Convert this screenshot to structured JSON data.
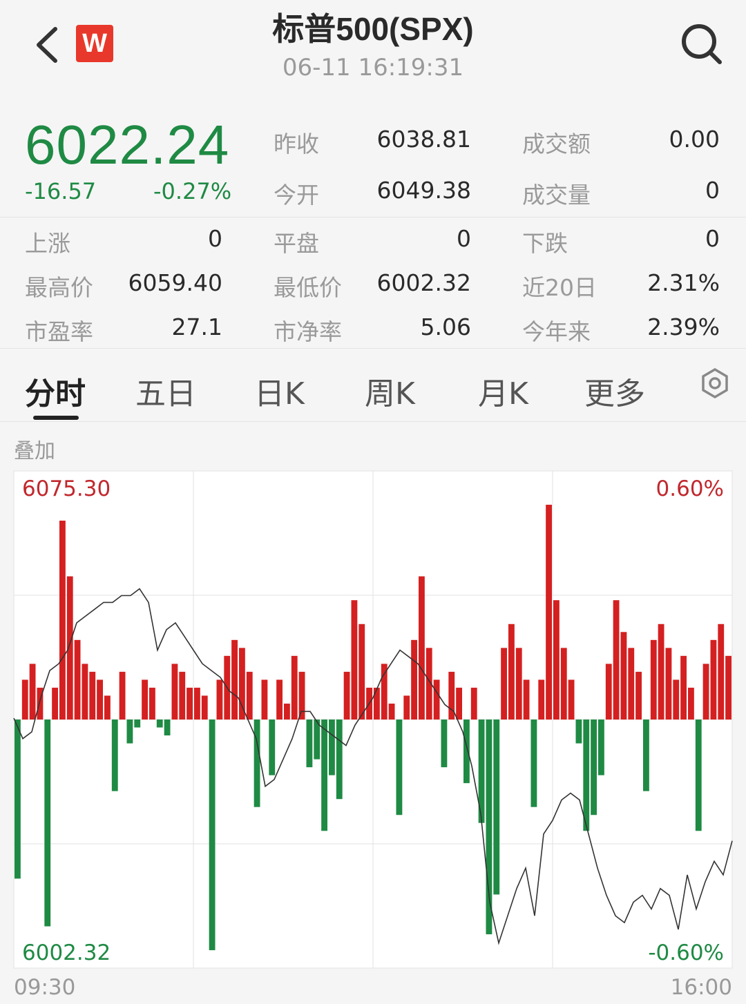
{
  "header": {
    "title": "标普500(SPX)",
    "timestamp": "06-11 16:19:31",
    "logo_text": "W",
    "back_icon": "chevron-left-icon",
    "search_icon": "search-icon"
  },
  "quote": {
    "price": "6022.24",
    "change": "-16.57",
    "change_pct": "-0.27%"
  },
  "stats": [
    {
      "label": "昨收",
      "value": "6038.81"
    },
    {
      "label": "成交额",
      "value": "0.00"
    },
    {
      "label": "今开",
      "value": "6049.38"
    },
    {
      "label": "成交量",
      "value": "0"
    },
    {
      "label": "上涨",
      "value": "0"
    },
    {
      "label": "平盘",
      "value": "0"
    },
    {
      "label": "下跌",
      "value": "0"
    },
    {
      "label": "最高价",
      "value": "6059.40"
    },
    {
      "label": "最低价",
      "value": "6002.32"
    },
    {
      "label": "近20日",
      "value": "2.31%"
    },
    {
      "label": "市盈率",
      "value": "27.1"
    },
    {
      "label": "市净率",
      "value": "5.06"
    },
    {
      "label": "今年来",
      "value": "2.39%"
    }
  ],
  "tabs": [
    {
      "label": "分时"
    },
    {
      "label": "五日"
    },
    {
      "label": "日K"
    },
    {
      "label": "周K"
    },
    {
      "label": "月K"
    },
    {
      "label": "更多"
    }
  ],
  "settings_icon": "gear-icon",
  "overlay_label": "叠加",
  "colors": {
    "up": "#d42020",
    "down": "#1f8a44",
    "line": "#333333",
    "grid": "#e2e2e2"
  },
  "chart_data": {
    "type": "line",
    "x_start": "09:30",
    "x_end": "16:00",
    "y_max_label": "6075.30",
    "y_min_label": "6002.32",
    "pct_max_label": "0.60%",
    "pct_min_label": "-0.60%",
    "ylim": [
      6002.32,
      6075.3
    ],
    "base": 6038.81,
    "price_series": [
      6039,
      6036,
      6037,
      6042,
      6046,
      6047,
      6049,
      6053,
      6054,
      6055,
      6056,
      6056,
      6057,
      6057,
      6058,
      6056,
      6049,
      6052,
      6053,
      6051,
      6049,
      6047,
      6046,
      6045,
      6043,
      6042,
      6039,
      6036,
      6029,
      6030,
      6033,
      6036,
      6040,
      6040,
      6038,
      6037,
      6036,
      6035,
      6038,
      6040,
      6042,
      6045,
      6047,
      6049,
      6048,
      6047,
      6045,
      6043,
      6041,
      6040,
      6037,
      6032,
      6025,
      6012,
      6006,
      6010,
      6014,
      6017,
      6010,
      6022,
      6024,
      6027,
      6028,
      6027,
      6022,
      6017,
      6013,
      6010,
      6009,
      6012,
      6013,
      6011,
      6014,
      6013,
      6008,
      6016,
      6011,
      6015,
      6018,
      6016,
      6021
    ],
    "volume_series": [
      -40,
      10,
      14,
      8,
      -52,
      8,
      50,
      36,
      20,
      14,
      12,
      10,
      6,
      -18,
      12,
      -6,
      -2,
      10,
      8,
      -2,
      -4,
      14,
      12,
      8,
      8,
      6,
      -58,
      10,
      16,
      20,
      18,
      12,
      -22,
      10,
      -14,
      10,
      4,
      16,
      12,
      -12,
      -10,
      -28,
      -14,
      -20,
      12,
      30,
      24,
      8,
      8,
      14,
      4,
      -24,
      6,
      20,
      36,
      18,
      10,
      -12,
      12,
      8,
      -16,
      8,
      -26,
      -54,
      -44,
      18,
      24,
      18,
      10,
      -22,
      10,
      54,
      30,
      18,
      10,
      -6,
      -28,
      -24,
      -14,
      14,
      30,
      22,
      18,
      12,
      -18,
      20,
      24,
      18,
      10,
      16,
      8,
      -28,
      14,
      20,
      24,
      16
    ]
  }
}
